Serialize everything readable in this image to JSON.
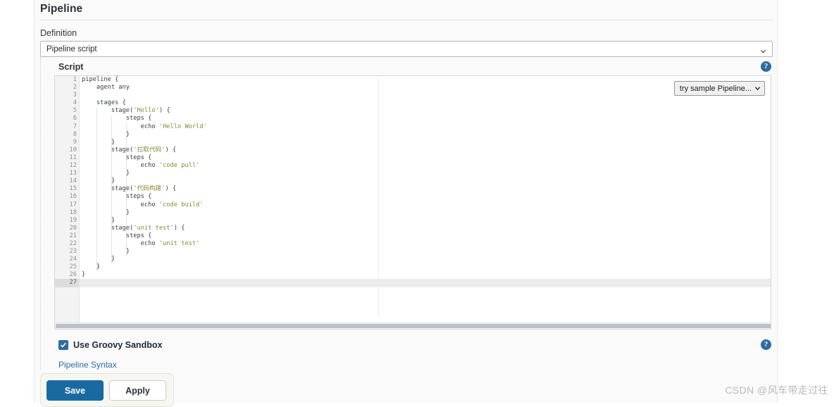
{
  "section": {
    "title": "Pipeline",
    "definition_label": "Definition",
    "definition_value": "Pipeline script",
    "script_label": "Script",
    "sample_select_value": "try sample Pipeline...",
    "sandbox_label": "Use Groovy Sandbox",
    "sandbox_checked": true,
    "syntax_link": "Pipeline Syntax",
    "help_icon": "help-circle-icon",
    "caret_icon": "chevron-down-icon",
    "check_icon": "check-icon"
  },
  "buttons": {
    "save": "Save",
    "apply": "Apply"
  },
  "editor": {
    "active_line": 27,
    "total_lines": 27,
    "lines": [
      {
        "n": 1,
        "fold": true,
        "text": "pipeline {"
      },
      {
        "n": 2,
        "fold": false,
        "text": "    agent any"
      },
      {
        "n": 3,
        "fold": false,
        "text": ""
      },
      {
        "n": 4,
        "fold": true,
        "text": "    stages {"
      },
      {
        "n": 5,
        "fold": true,
        "text": "        stage('Hello') {"
      },
      {
        "n": 6,
        "fold": true,
        "text": "            steps {"
      },
      {
        "n": 7,
        "fold": false,
        "text": "                echo 'Hello World'"
      },
      {
        "n": 8,
        "fold": false,
        "text": "            }"
      },
      {
        "n": 9,
        "fold": false,
        "text": "        }"
      },
      {
        "n": 10,
        "fold": true,
        "text": "        stage('拉取代码') {"
      },
      {
        "n": 11,
        "fold": true,
        "text": "            steps {"
      },
      {
        "n": 12,
        "fold": false,
        "text": "                echo 'code pull'"
      },
      {
        "n": 13,
        "fold": false,
        "text": "            }"
      },
      {
        "n": 14,
        "fold": false,
        "text": "        }"
      },
      {
        "n": 15,
        "fold": true,
        "text": "        stage('代码构建') {"
      },
      {
        "n": 16,
        "fold": true,
        "text": "            steps {"
      },
      {
        "n": 17,
        "fold": false,
        "text": "                echo 'code build'"
      },
      {
        "n": 18,
        "fold": false,
        "text": "            }"
      },
      {
        "n": 19,
        "fold": false,
        "text": "        }"
      },
      {
        "n": 20,
        "fold": true,
        "text": "        stage('unit test') {"
      },
      {
        "n": 21,
        "fold": true,
        "text": "            steps {"
      },
      {
        "n": 22,
        "fold": false,
        "text": "                echo 'unit test'"
      },
      {
        "n": 23,
        "fold": false,
        "text": "            }"
      },
      {
        "n": 24,
        "fold": false,
        "text": "        }"
      },
      {
        "n": 25,
        "fold": false,
        "text": "    }"
      },
      {
        "n": 26,
        "fold": false,
        "text": "}"
      },
      {
        "n": 27,
        "fold": false,
        "text": ""
      }
    ]
  },
  "watermark": "CSDN @风车带走过往"
}
